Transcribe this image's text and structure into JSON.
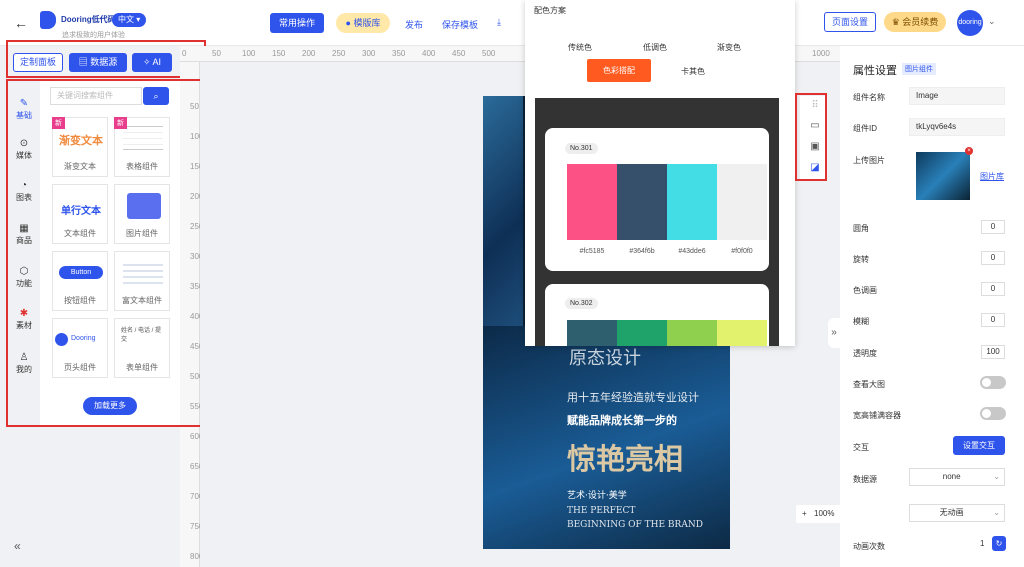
{
  "topbar": {
    "brand": "Dooring低代码",
    "lang": "中文",
    "slogan": "追求极致的用户体验",
    "btn_common": "常用操作",
    "btn_templates": "模版库",
    "publish": "发布",
    "save_template": "保存模板",
    "page_settings": "页面设置",
    "vip": "会员续费",
    "user": "dooring"
  },
  "toolbar": {
    "custom_panel": "定制面板",
    "datasource": "数据源",
    "ai": "AI"
  },
  "leftnav": [
    "基础",
    "媒体",
    "图表",
    "商品",
    "功能",
    "素材",
    "我的"
  ],
  "leftpanel": {
    "search_placeholder": "关键词搜索组件",
    "components": [
      {
        "preview": "渐变文本",
        "label": "渐变文本",
        "new": "新"
      },
      {
        "preview": "",
        "label": "表格组件",
        "new": "新"
      },
      {
        "preview": "单行文本",
        "label": "文本组件"
      },
      {
        "preview": "",
        "label": "图片组件"
      },
      {
        "preview": "Button",
        "label": "按钮组件"
      },
      {
        "preview": "",
        "label": "富文本组件"
      },
      {
        "preview": "Dooring",
        "label": "页头组件"
      },
      {
        "preview": "姓名 / 电话 / 提交",
        "label": "表单组件"
      }
    ],
    "load_more": "加载更多"
  },
  "ruler": {
    "x": [
      "0",
      "50",
      "100",
      "150",
      "200",
      "250",
      "300",
      "350",
      "400",
      "450",
      "500",
      "1000"
    ],
    "y": [
      "50",
      "100",
      "150",
      "200",
      "250",
      "300",
      "350",
      "400",
      "450",
      "500",
      "550",
      "600",
      "650",
      "700",
      "750",
      "800"
    ]
  },
  "poster": {
    "line1": "用十五年经验造就专业设计",
    "line2": "赋能品牌成长第一步的",
    "headline": "惊艳亮相",
    "tagline": "艺术·设计·美学",
    "en1": "THE PERFECT",
    "en2": "BEGINNING OF THE BRAND",
    "partial": "原态设计"
  },
  "colorpanel": {
    "title": "配色方案",
    "tabs": [
      "传统色",
      "低调色",
      "渐变色",
      "色彩搭配",
      "卡其色"
    ],
    "active_tab": "色彩搭配",
    "palettes": [
      {
        "no": "No.301",
        "colors": [
          "#fc5185",
          "#364f6b",
          "#43dde6",
          "#f0f0f0"
        ]
      },
      {
        "no": "No.302",
        "colors": [
          "#2d5f6e",
          "#20a36a",
          "#8fd14f",
          "#e3f26c"
        ]
      }
    ]
  },
  "zoom": {
    "level": "100%",
    "minus": "-",
    "plus": "+"
  },
  "props": {
    "title": "属性设置",
    "tag": "图片组件",
    "name_label": "组件名称",
    "name_value": "Image",
    "id_label": "组件ID",
    "id_value": "tkLyqv6e4s",
    "upload_label": "上传图片",
    "gallery": "图片库",
    "radius_label": "圆角",
    "radius": "0",
    "rotate_label": "旋转",
    "rotate": "0",
    "hue_label": "色调画",
    "hue": "0",
    "blur_label": "模糊",
    "blur": "0",
    "opacity_label": "透明度",
    "opacity": "100",
    "preview_label": "查看大图",
    "fill_label": "宽高铺满容器",
    "interact_label": "交互",
    "interact_btn": "设置交互",
    "datasource_label": "数据源",
    "datasource": "none",
    "animation": "无动画",
    "anim_count_label": "动画次数",
    "anim_count": "1"
  }
}
